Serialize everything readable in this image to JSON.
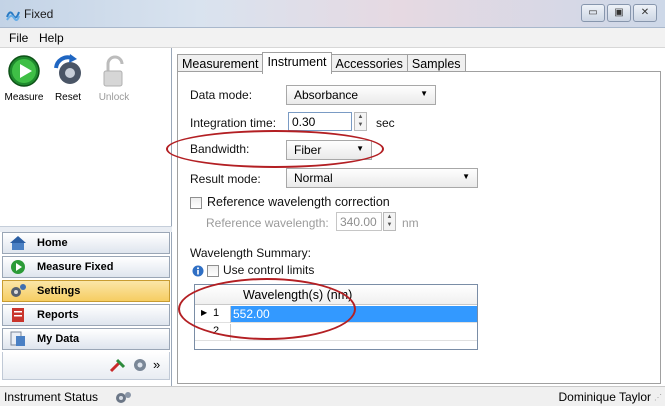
{
  "window": {
    "title": "Fixed",
    "icon": "app-icon",
    "buttons": [
      "minimize",
      "maximize",
      "close"
    ]
  },
  "menu": [
    "File",
    "Help"
  ],
  "toolbar": {
    "measure": "Measure",
    "reset": "Reset",
    "unlock": "Unlock"
  },
  "nav": {
    "items": [
      {
        "label": "Home",
        "icon": "home-icon"
      },
      {
        "label": "Measure Fixed",
        "icon": "measure-icon"
      },
      {
        "label": "Settings",
        "icon": "settings-icon",
        "active": true
      },
      {
        "label": "Reports",
        "icon": "reports-icon"
      },
      {
        "label": "My Data",
        "icon": "my-data-icon"
      }
    ],
    "chevron": "»"
  },
  "tabs": [
    "Measurement",
    "Instrument",
    "Accessories",
    "Samples"
  ],
  "active_tab": "Instrument",
  "form": {
    "data_mode_label": "Data mode:",
    "data_mode_value": "Absorbance",
    "integration_label": "Integration time:",
    "integration_value": "0.30",
    "integration_unit": "sec",
    "bandwidth_label": "Bandwidth:",
    "bandwidth_value": "Fiber",
    "result_label": "Result mode:",
    "result_value": "Normal",
    "ref_corr_label": "Reference wavelength correction",
    "ref_wl_label": "Reference wavelength:",
    "ref_wl_value": "340.00",
    "ref_wl_unit": "nm",
    "summary_label": "Wavelength Summary:",
    "control_limits_label": "Use control limits"
  },
  "grid": {
    "header": "Wavelength(s) (nm)",
    "rows": [
      {
        "num": "1",
        "value": "552.00"
      },
      {
        "num": "2",
        "value": ""
      }
    ]
  },
  "status": {
    "left": "Instrument Status",
    "right": "Dominique Taylor"
  },
  "colors": {
    "selection": "#3399ff",
    "annotation": "#b31f23",
    "active_nav": "#f6cd62"
  }
}
